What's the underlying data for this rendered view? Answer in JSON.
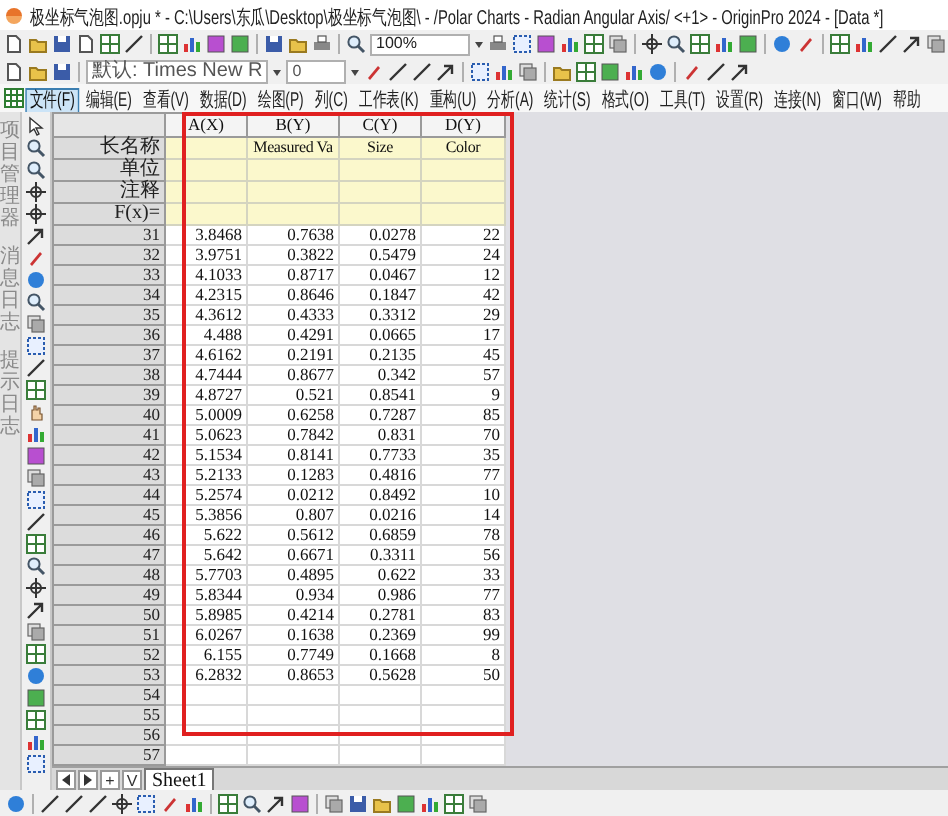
{
  "window": {
    "title": "极坐标气泡图.opju * - C:\\Users\\东瓜\\Desktop\\极坐标气泡图\\ - /Polar Charts - Radian Angular Axis/ <+1> - OriginPro 2024 - [Data *]"
  },
  "toolbar": {
    "zoom": "100%",
    "font": "默认: Times New R",
    "font_size": "0"
  },
  "menu": [
    {
      "label": "文件(F)",
      "selected": true
    },
    {
      "label": "编辑(E)",
      "selected": false
    },
    {
      "label": "查看(V)",
      "selected": false
    },
    {
      "label": "数据(D)",
      "selected": false
    },
    {
      "label": "绘图(P)",
      "selected": false
    },
    {
      "label": "列(C)",
      "selected": false
    },
    {
      "label": "工作表(K)",
      "selected": false
    },
    {
      "label": "重构(U)",
      "selected": false
    },
    {
      "label": "分析(A)",
      "selected": false
    },
    {
      "label": "统计(S)",
      "selected": false
    },
    {
      "label": "格式(O)",
      "selected": false
    },
    {
      "label": "工具(T)",
      "selected": false
    },
    {
      "label": "设置(R)",
      "selected": false
    },
    {
      "label": "连接(N)",
      "selected": false
    },
    {
      "label": "窗口(W)",
      "selected": false
    },
    {
      "label": "帮助",
      "selected": false
    }
  ],
  "side_panels": [
    "项目管理器",
    "消息日志",
    "提示日志"
  ],
  "worksheet": {
    "columns": [
      {
        "name": "A(X)"
      },
      {
        "name": "B(Y)",
        "long_name": "Measured Va"
      },
      {
        "name": "C(Y)",
        "long_name": "Size"
      },
      {
        "name": "D(Y)",
        "long_name": "Color"
      }
    ],
    "label_rows": [
      "长名称",
      "单位",
      "注释",
      "F(x)="
    ],
    "rows": [
      {
        "index": "31",
        "cells": [
          "3.8468",
          "0.7638",
          "0.0278",
          "22"
        ]
      },
      {
        "index": "32",
        "cells": [
          "3.9751",
          "0.3822",
          "0.5479",
          "24"
        ]
      },
      {
        "index": "33",
        "cells": [
          "4.1033",
          "0.8717",
          "0.0467",
          "12"
        ]
      },
      {
        "index": "34",
        "cells": [
          "4.2315",
          "0.8646",
          "0.1847",
          "42"
        ]
      },
      {
        "index": "35",
        "cells": [
          "4.3612",
          "0.4333",
          "0.3312",
          "29"
        ]
      },
      {
        "index": "36",
        "cells": [
          "4.488",
          "0.4291",
          "0.0665",
          "17"
        ]
      },
      {
        "index": "37",
        "cells": [
          "4.6162",
          "0.2191",
          "0.2135",
          "45"
        ]
      },
      {
        "index": "38",
        "cells": [
          "4.7444",
          "0.8677",
          "0.342",
          "57"
        ]
      },
      {
        "index": "39",
        "cells": [
          "4.8727",
          "0.521",
          "0.8541",
          "9"
        ]
      },
      {
        "index": "40",
        "cells": [
          "5.0009",
          "0.6258",
          "0.7287",
          "85"
        ]
      },
      {
        "index": "41",
        "cells": [
          "5.0623",
          "0.7842",
          "0.831",
          "70"
        ]
      },
      {
        "index": "42",
        "cells": [
          "5.1534",
          "0.8141",
          "0.7733",
          "35"
        ]
      },
      {
        "index": "43",
        "cells": [
          "5.2133",
          "0.1283",
          "0.4816",
          "77"
        ]
      },
      {
        "index": "44",
        "cells": [
          "5.2574",
          "0.0212",
          "0.8492",
          "10"
        ]
      },
      {
        "index": "45",
        "cells": [
          "5.3856",
          "0.807",
          "0.0216",
          "14"
        ]
      },
      {
        "index": "46",
        "cells": [
          "5.622",
          "0.5612",
          "0.6859",
          "78"
        ]
      },
      {
        "index": "47",
        "cells": [
          "5.642",
          "0.6671",
          "0.3311",
          "56"
        ]
      },
      {
        "index": "48",
        "cells": [
          "5.7703",
          "0.4895",
          "0.622",
          "33"
        ]
      },
      {
        "index": "49",
        "cells": [
          "5.8344",
          "0.934",
          "0.986",
          "77"
        ]
      },
      {
        "index": "50",
        "cells": [
          "5.8985",
          "0.4214",
          "0.2781",
          "83"
        ]
      },
      {
        "index": "51",
        "cells": [
          "6.0267",
          "0.1638",
          "0.2369",
          "99"
        ]
      },
      {
        "index": "52",
        "cells": [
          "6.155",
          "0.7749",
          "0.1668",
          "8"
        ]
      },
      {
        "index": "53",
        "cells": [
          "6.2832",
          "0.8653",
          "0.5628",
          "50"
        ]
      },
      {
        "index": "54"
      },
      {
        "index": "55"
      },
      {
        "index": "56"
      },
      {
        "index": "57"
      }
    ]
  },
  "sheet_nav": [
    "+",
    "V"
  ],
  "sheet_tabs": [
    {
      "label": "Sheet1",
      "selected": true
    }
  ]
}
